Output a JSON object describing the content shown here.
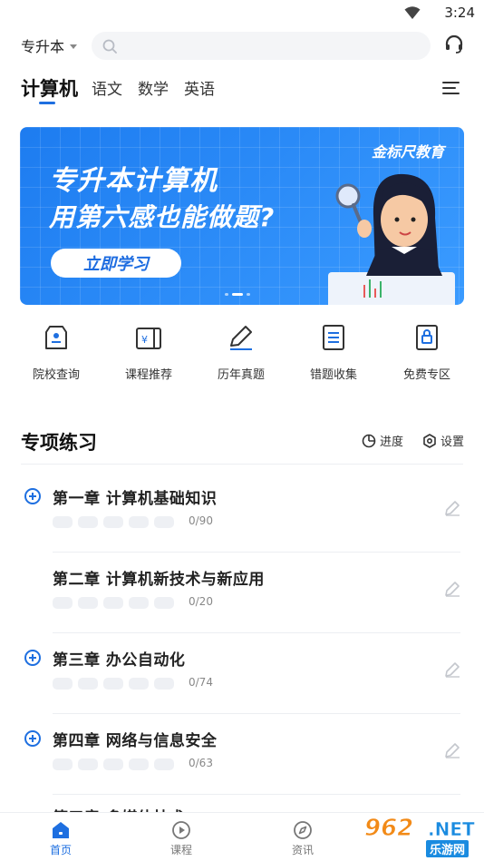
{
  "status_bar": {
    "time": "3:24"
  },
  "header": {
    "city": "专升本",
    "search_placeholder": ""
  },
  "tabs": [
    {
      "label": "计算机",
      "active": true
    },
    {
      "label": "语文",
      "active": false
    },
    {
      "label": "数学",
      "active": false
    },
    {
      "label": "英语",
      "active": false
    }
  ],
  "banner": {
    "brand": "金标尺教育",
    "headline": "专升本计算机",
    "subline": "用第六感也能做题?",
    "cta": "立即学习"
  },
  "quick_entries": [
    {
      "label": "院校查询",
      "icon": "school-badge-icon"
    },
    {
      "label": "课程推荐",
      "icon": "course-book-icon"
    },
    {
      "label": "历年真题",
      "icon": "pencil-exam-icon"
    },
    {
      "label": "错题收集",
      "icon": "list-document-icon"
    },
    {
      "label": "免费专区",
      "icon": "lock-document-icon"
    }
  ],
  "section": {
    "title": "专项练习",
    "progress_label": "进度",
    "settings_label": "设置"
  },
  "chapters": [
    {
      "title": "第一章  计算机基础知识",
      "count": "0/90",
      "expandable": true
    },
    {
      "title": "第二章  计算机新技术与新应用",
      "count": "0/20",
      "expandable": false
    },
    {
      "title": "第三章  办公自动化",
      "count": "0/74",
      "expandable": true
    },
    {
      "title": "第四章  网络与信息安全",
      "count": "0/63",
      "expandable": true
    },
    {
      "title": "第五章  多媒体技术",
      "count": "",
      "expandable": false
    }
  ],
  "bottom_nav": [
    {
      "label": "首页",
      "active": true
    },
    {
      "label": "课程",
      "active": false
    },
    {
      "label": "资讯",
      "active": false
    }
  ],
  "watermark": {
    "number": "962",
    "suffix": ".NET",
    "site": "乐游网"
  },
  "colors": {
    "accent": "#1e6fe0",
    "banner": "#2a8cf5"
  }
}
